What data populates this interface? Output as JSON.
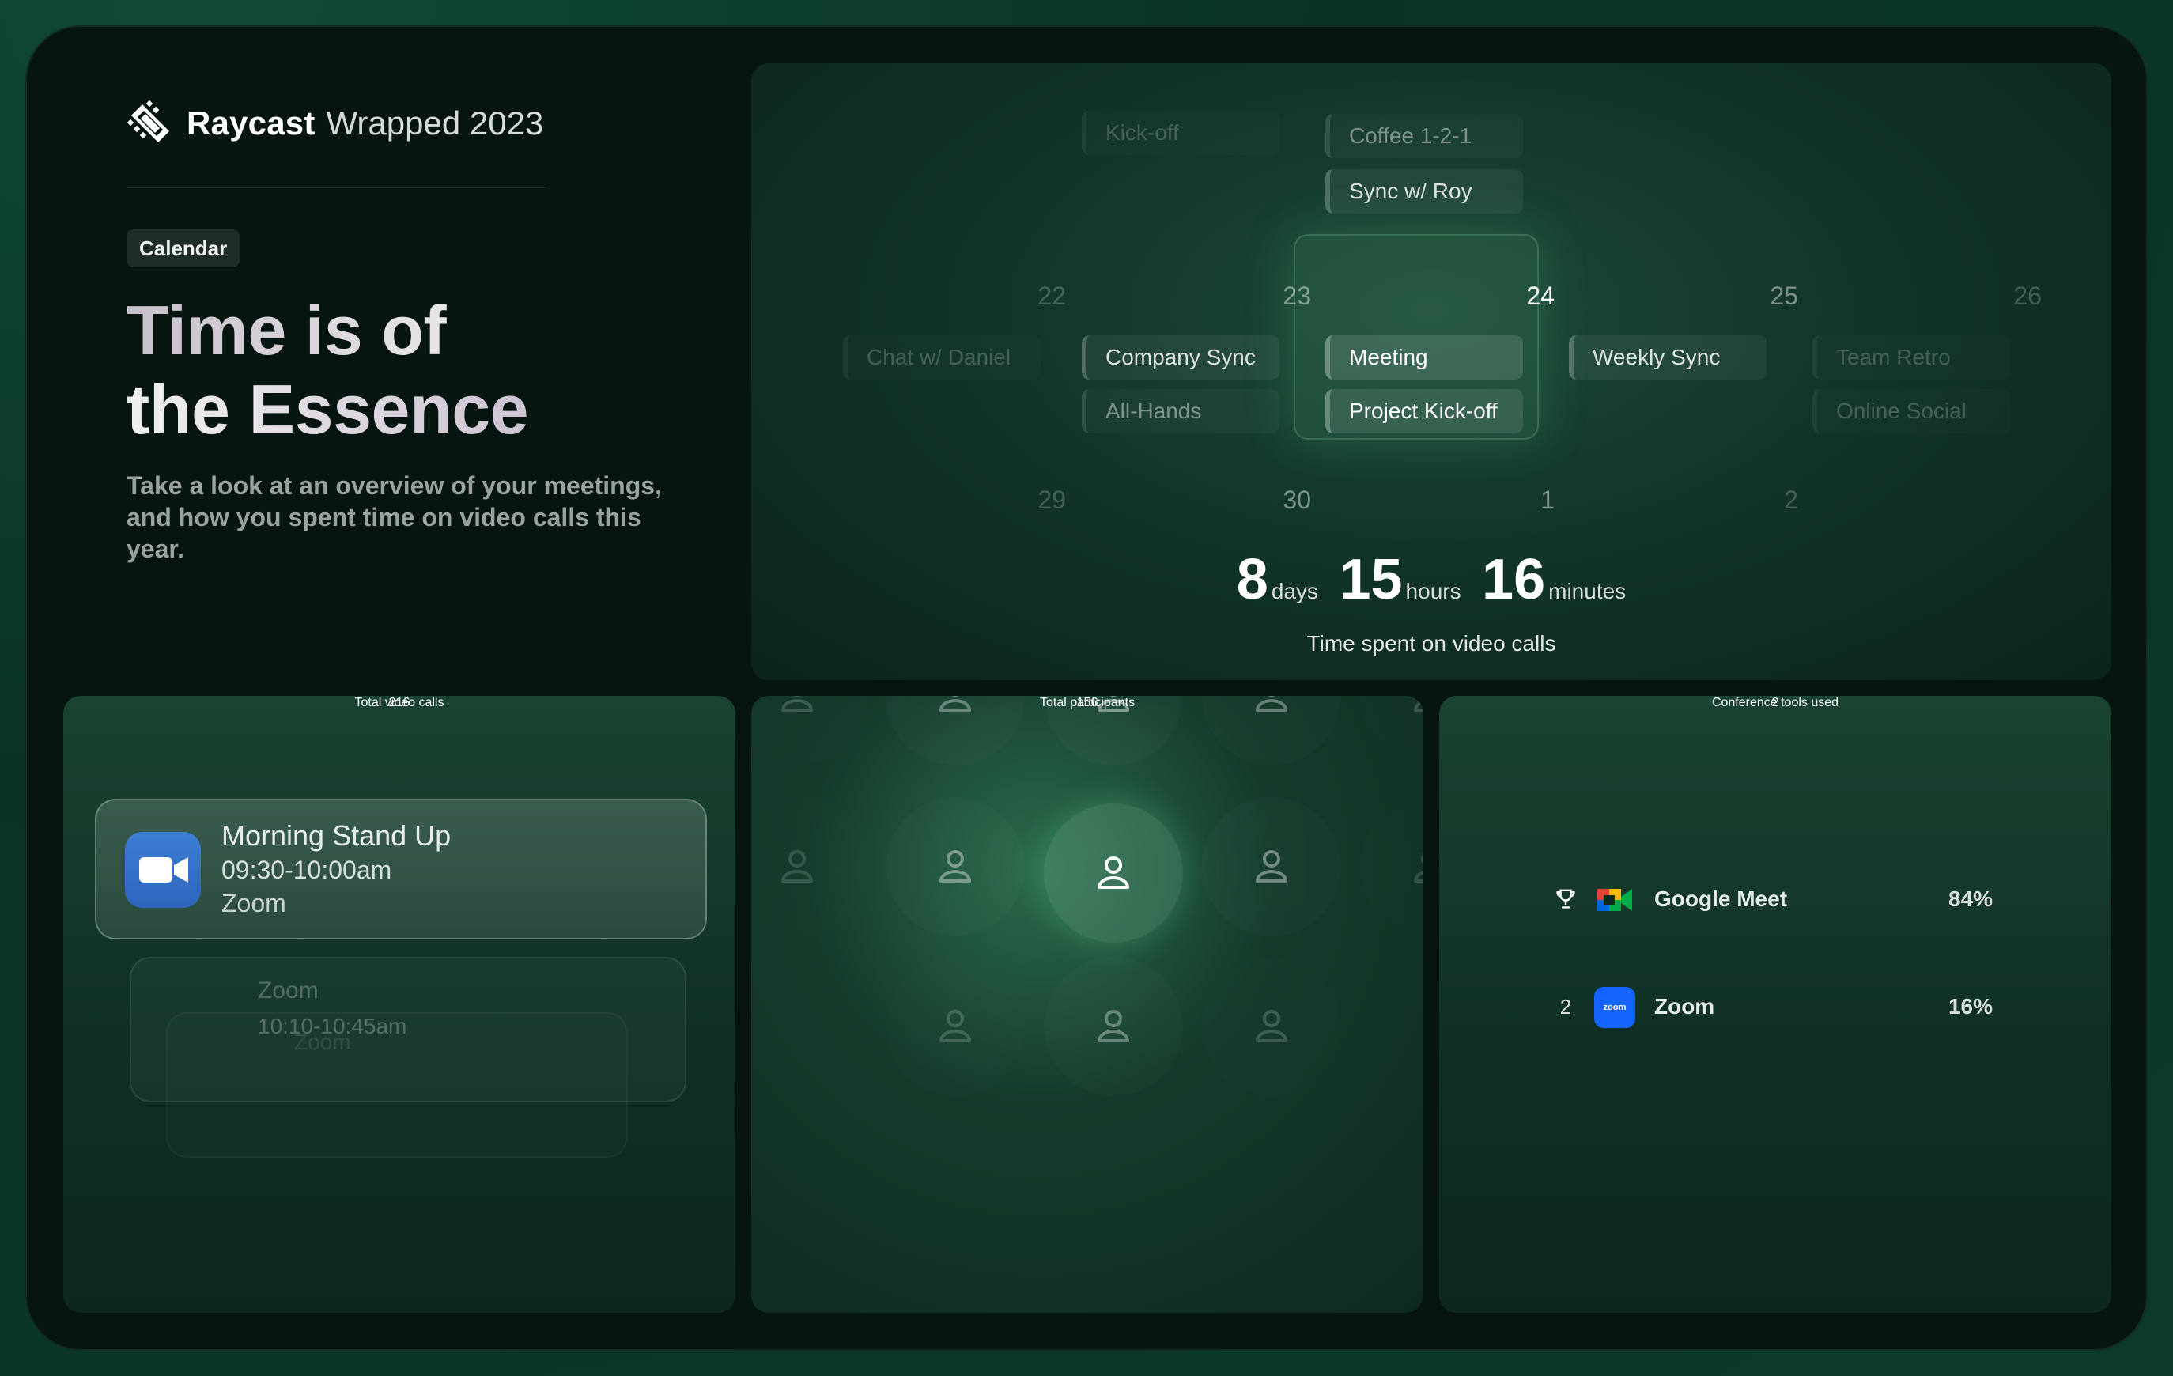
{
  "brand": {
    "name": "Raycast",
    "subtitle": "Wrapped 2023"
  },
  "tag": "Calendar",
  "headline": {
    "line1": "Time is of",
    "line2": "the Essence"
  },
  "description": "Take a look at an overview of your meetings, and how you spent time on video calls this year.",
  "calendar": {
    "top_events": [
      "Kick-off",
      "Coffee 1-2-1",
      "Sync w/ Roy"
    ],
    "days": [
      "22",
      "23",
      "24",
      "25",
      "26"
    ],
    "next_days": [
      "29",
      "30",
      "1",
      "2"
    ],
    "events": {
      "d22": [
        "Chat w/ Daniel"
      ],
      "d23": [
        "Company Sync",
        "All-Hands"
      ],
      "d24": [
        "Meeting",
        "Project Kick-off"
      ],
      "d25": [
        "Weekly Sync"
      ],
      "d26": [
        "Team Retro",
        "Online Social"
      ]
    },
    "time": {
      "days": "8",
      "days_unit": "days",
      "hours": "15",
      "hours_unit": "hours",
      "minutes": "16",
      "minutes_unit": "minutes"
    },
    "caption": "Time spent on video calls"
  },
  "calls": {
    "card": {
      "title": "Morning Stand Up",
      "time": "09:30-10:00am",
      "app": "Zoom"
    },
    "stacked": [
      {
        "title": "Zoom",
        "time": "10:10-10:45am"
      },
      {
        "title": "Zoom"
      }
    ],
    "total": "216",
    "label": "Total video calls"
  },
  "participants": {
    "total": "156",
    "label": "Total participants"
  },
  "tools": {
    "items": [
      {
        "rank_icon": "trophy-icon",
        "name": "Google Meet",
        "pct": "84%"
      },
      {
        "rank": "2",
        "name": "Zoom",
        "pct": "16%",
        "logo_text": "zoom"
      }
    ],
    "total": "2",
    "label": "Conference tools used"
  },
  "colors": {
    "accent": "#2b6b4e",
    "zoom_blue": "#2e65bd"
  }
}
